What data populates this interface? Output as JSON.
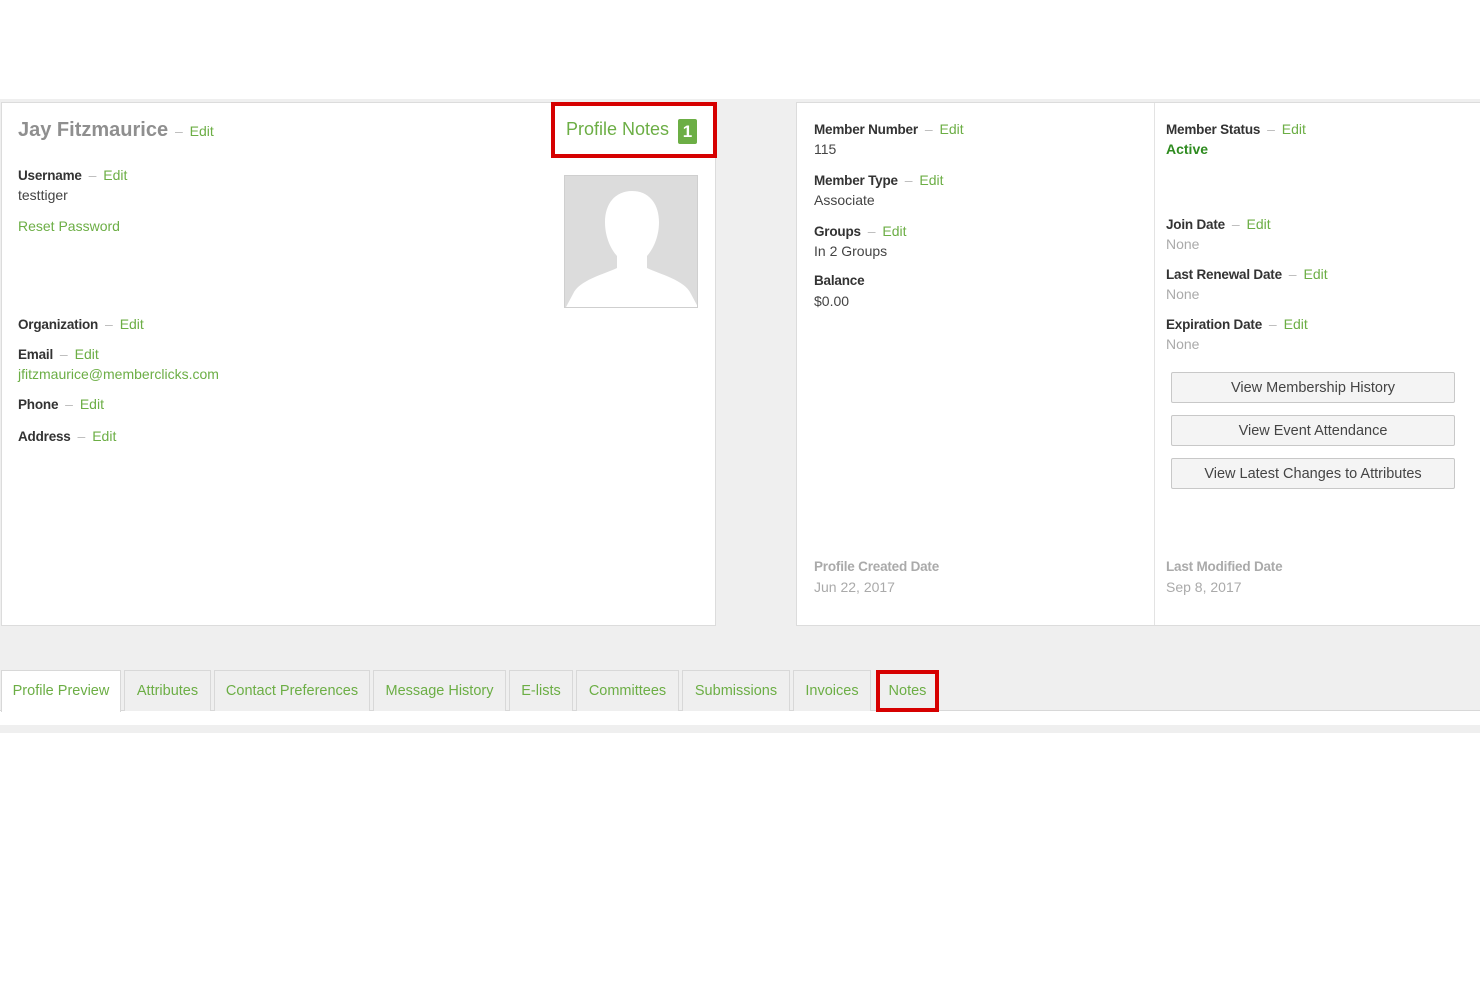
{
  "profile": {
    "name": "Jay Fitzmaurice",
    "edit_label": "Edit",
    "dash": "–",
    "username_label": "Username",
    "username_value": "testtiger",
    "reset_password": "Reset Password",
    "organization_label": "Organization",
    "email_label": "Email",
    "email_value": "jfitzmaurice@memberclicks.com",
    "phone_label": "Phone",
    "address_label": "Address",
    "notes_label": "Profile Notes",
    "notes_count": "1"
  },
  "member": {
    "number_label": "Member Number",
    "number_value": "115",
    "type_label": "Member Type",
    "type_value": "Associate",
    "groups_label": "Groups",
    "groups_value": "In 2 Groups",
    "balance_label": "Balance",
    "balance_value": "$0.00",
    "created_label": "Profile Created Date",
    "created_value": "Jun 22, 2017",
    "status_label": "Member Status",
    "status_value": "Active",
    "join_label": "Join Date",
    "join_value": "None",
    "renewal_label": "Last Renewal Date",
    "renewal_value": "None",
    "expiration_label": "Expiration Date",
    "expiration_value": "None",
    "modified_label": "Last Modified Date",
    "modified_value": "Sep 8, 2017"
  },
  "buttons": {
    "membership_history": "View Membership History",
    "event_attendance": "View Event Attendance",
    "latest_changes": "View Latest Changes to Attributes"
  },
  "tabs": [
    {
      "label": "Profile Preview",
      "active": true
    },
    {
      "label": "Attributes"
    },
    {
      "label": "Contact Preferences"
    },
    {
      "label": "Message History"
    },
    {
      "label": "E-lists"
    },
    {
      "label": "Committees"
    },
    {
      "label": "Submissions"
    },
    {
      "label": "Invoices"
    },
    {
      "label": "Notes",
      "highlighted": true
    }
  ],
  "colors": {
    "accent_green": "#6cae45",
    "highlight_red": "#d60000",
    "active_status": "#2e8b1f"
  },
  "icons": {
    "avatar": "person-silhouette-icon"
  }
}
